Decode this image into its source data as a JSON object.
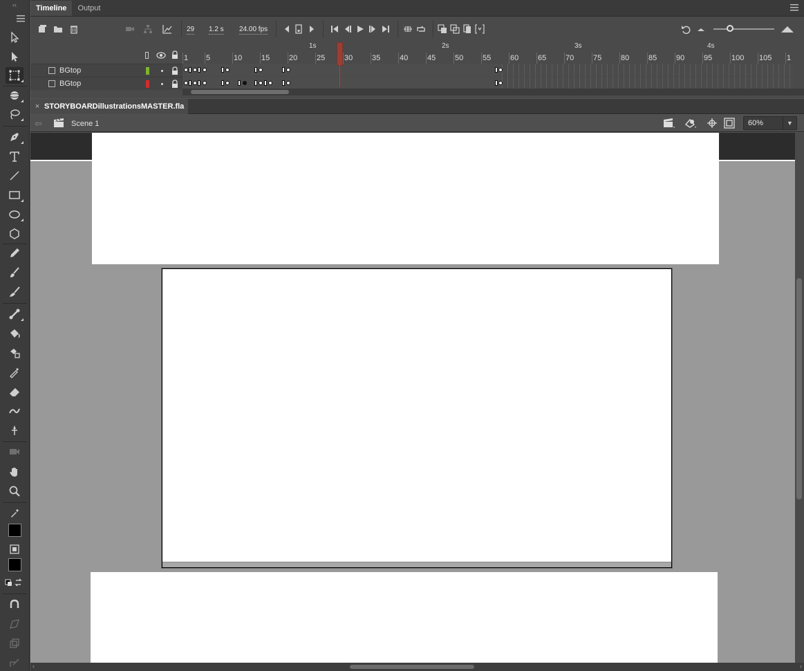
{
  "timeline": {
    "tabs": [
      {
        "label": "Timeline",
        "active": true
      },
      {
        "label": "Output",
        "active": false
      }
    ],
    "current_frame": "29",
    "elapsed_time": "1.2 s",
    "frame_rate": "24.00 fps",
    "second_markers": [
      "1s",
      "2s",
      "3s",
      "4s"
    ],
    "frame_ticks": [
      "1",
      "5",
      "10",
      "15",
      "20",
      "25",
      "30",
      "35",
      "40",
      "45",
      "50",
      "55",
      "60",
      "65",
      "70",
      "75",
      "80",
      "85",
      "90",
      "95",
      "100",
      "105",
      "1"
    ],
    "layers": [
      {
        "name": "BGtop",
        "color": "#7db32d"
      },
      {
        "name": "BGtop",
        "color": "#d42b2b"
      }
    ]
  },
  "document": {
    "tab_close": "×",
    "tab_name": "STORYBOARDillustrationsMASTER.fla",
    "scene_label": "Scene 1",
    "zoom_value": "60%"
  },
  "toolbar": {
    "collapse": "‹‹",
    "fill_color": "#000000",
    "stroke_color": "#000000"
  },
  "icons": {
    "selection": "selection-arrow-icon",
    "subselection": "subselection-arrow-icon",
    "free_transform": "free-transform-icon",
    "3d_rotation": "3d-rotation-icon",
    "lasso": "lasso-icon",
    "pen": "pen-icon",
    "text": "text-icon",
    "line": "line-icon",
    "rectangle": "rectangle-icon",
    "oval": "oval-icon",
    "polystar": "polystar-icon",
    "pencil": "pencil-icon",
    "paint_brush": "paint-brush-icon",
    "brush": "brush-icon",
    "bone": "bone-icon",
    "paint_bucket": "paint-bucket-icon",
    "ink_bottle": "ink-bottle-icon",
    "eyedropper": "eyedropper-icon",
    "eraser": "eraser-icon",
    "width": "width-tool-icon",
    "asset_warp": "asset-warp-icon",
    "camera": "camera-icon",
    "hand": "hand-icon",
    "zoom": "zoom-icon"
  }
}
